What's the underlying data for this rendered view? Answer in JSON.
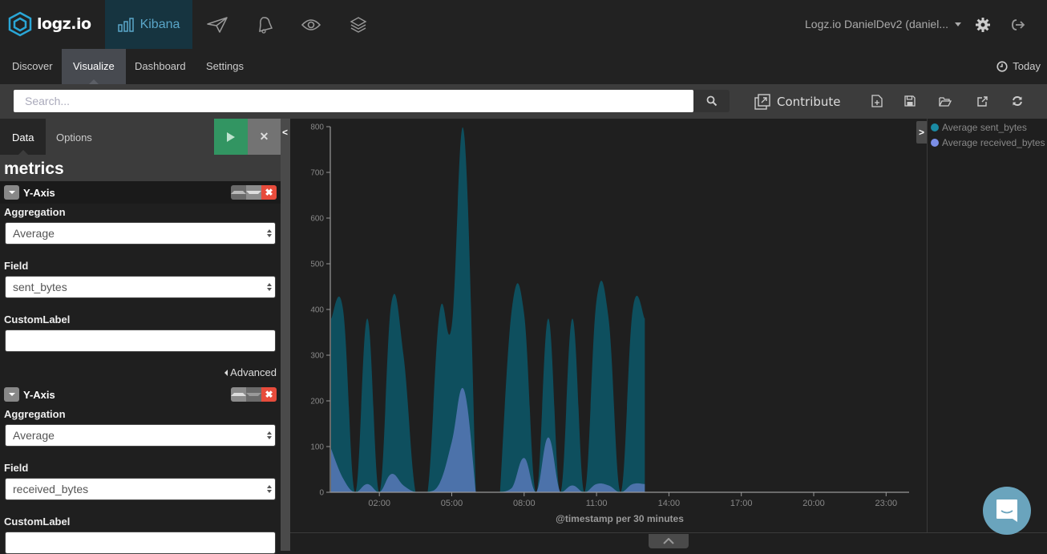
{
  "topbar": {
    "logo_text": "logz.io",
    "kibana_label": "Kibana",
    "icons": [
      "bar-chart-icon",
      "paper-plane-icon",
      "bell-icon",
      "eye-icon",
      "layers-icon"
    ],
    "account_label": "Logz.io DanielDev2 (daniel...",
    "settings_icon": "gear-icon",
    "logout_icon": "sign-out-icon"
  },
  "navbar": {
    "items": [
      {
        "label": "Discover",
        "active": false
      },
      {
        "label": "Visualize",
        "active": true
      },
      {
        "label": "Dashboard",
        "active": false
      },
      {
        "label": "Settings",
        "active": false
      }
    ],
    "time_label": "Today"
  },
  "searchbar": {
    "placeholder": "Search...",
    "value": "",
    "contribute_label": "Contribute",
    "tools": [
      "new-document-icon",
      "save-icon",
      "open-folder-icon",
      "share-icon",
      "refresh-icon"
    ]
  },
  "sidebar": {
    "tabs": [
      {
        "label": "Data",
        "active": true
      },
      {
        "label": "Options",
        "active": false
      }
    ],
    "section_title": "metrics",
    "aggregations": [
      {
        "title": "Y-Axis",
        "aggregation_label": "Aggregation",
        "aggregation_value": "Average",
        "field_label": "Field",
        "field_value": "sent_bytes",
        "custom_label_label": "CustomLabel",
        "custom_label_value": "",
        "advanced_label": "Advanced"
      },
      {
        "title": "Y-Axis",
        "aggregation_label": "Aggregation",
        "aggregation_value": "Average",
        "field_label": "Field",
        "field_value": "received_bytes",
        "custom_label_label": "CustomLabel",
        "custom_label_value": ""
      }
    ]
  },
  "chart_data": {
    "type": "area",
    "title": "",
    "xlabel": "@timestamp per 30 minutes",
    "ylabel": "",
    "ylim": [
      0,
      800
    ],
    "xlim_hours": [
      0,
      24
    ],
    "y_ticks": [
      0,
      100,
      200,
      300,
      400,
      500,
      600,
      700,
      800
    ],
    "x_ticks": [
      "02:00",
      "05:00",
      "08:00",
      "11:00",
      "14:00",
      "17:00",
      "20:00",
      "23:00"
    ],
    "x_tick_hours": [
      2,
      5,
      8,
      11,
      14,
      17,
      20,
      23
    ],
    "x": [
      "00:00",
      "00:30",
      "01:00",
      "01:30",
      "02:00",
      "02:30",
      "03:00",
      "03:30",
      "04:00",
      "04:30",
      "05:00",
      "05:30",
      "06:00",
      "06:30",
      "07:00",
      "07:30",
      "08:00",
      "08:30",
      "09:00",
      "09:30",
      "10:00",
      "10:30",
      "11:00",
      "11:30",
      "12:00",
      "12:30",
      "13:00"
    ],
    "x_hours": [
      0,
      0.5,
      1,
      1.5,
      2,
      2.5,
      3,
      3.5,
      4,
      4.5,
      5,
      5.5,
      6,
      6.5,
      7,
      7.5,
      8,
      8.5,
      9,
      9.5,
      10,
      10.5,
      11,
      11.5,
      12,
      12.5,
      13
    ],
    "series": [
      {
        "name": "Average sent_bytes",
        "color": "#0e4f5e",
        "legend_color": "#1a8aa3",
        "values": [
          380,
          398,
          0,
          380,
          0,
          415,
          300,
          0,
          0,
          395,
          365,
          790,
          0,
          null,
          0,
          405,
          390,
          0,
          380,
          0,
          380,
          0,
          420,
          380,
          0,
          400,
          380
        ]
      },
      {
        "name": "Average received_bytes",
        "color": "#4c72aa",
        "legend_color": "#7b8ee6",
        "values": [
          95,
          30,
          0,
          18,
          0,
          40,
          15,
          0,
          0,
          20,
          110,
          225,
          0,
          null,
          0,
          10,
          75,
          0,
          120,
          0,
          15,
          0,
          18,
          15,
          0,
          18,
          18
        ]
      }
    ],
    "legend_position": "right",
    "grid": false
  }
}
